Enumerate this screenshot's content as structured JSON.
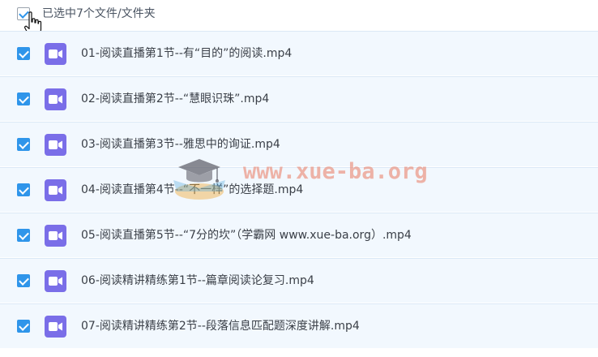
{
  "header": {
    "selection_label": "已选中7个文件/文件夹",
    "select_all_checked": true
  },
  "files": [
    {
      "name": "01-阅读直播第1节--有“目的”的阅读.mp4",
      "checked": true,
      "icon": "video-file-icon"
    },
    {
      "name": "02-阅读直播第2节--“慧眼识珠”.mp4",
      "checked": true,
      "icon": "video-file-icon"
    },
    {
      "name": "03-阅读直播第3节--雅思中的询证.mp4",
      "checked": true,
      "icon": "video-file-icon"
    },
    {
      "name": "04-阅读直播第4节--“不一样”的选择题.mp4",
      "checked": true,
      "icon": "video-file-icon"
    },
    {
      "name": "05-阅读直播第5节--“7分的坎”（学霸网 www.xue-ba.org）.mp4",
      "checked": true,
      "icon": "video-file-icon"
    },
    {
      "name": "06-阅读精讲精练第1节--篇章阅读论复习.mp4",
      "checked": true,
      "icon": "video-file-icon"
    },
    {
      "name": "07-阅读精讲精练第2节--段落信息匹配题深度讲解.mp4",
      "checked": true,
      "icon": "video-file-icon"
    }
  ],
  "watermark": {
    "text": "www.xue-ba.org",
    "icon": "graduation-cap-logo"
  },
  "colors": {
    "accent": "#2f95ea",
    "row_background": "#f2f8fe",
    "video_icon": "#7a6ee8",
    "watermark": "#e9785f"
  }
}
